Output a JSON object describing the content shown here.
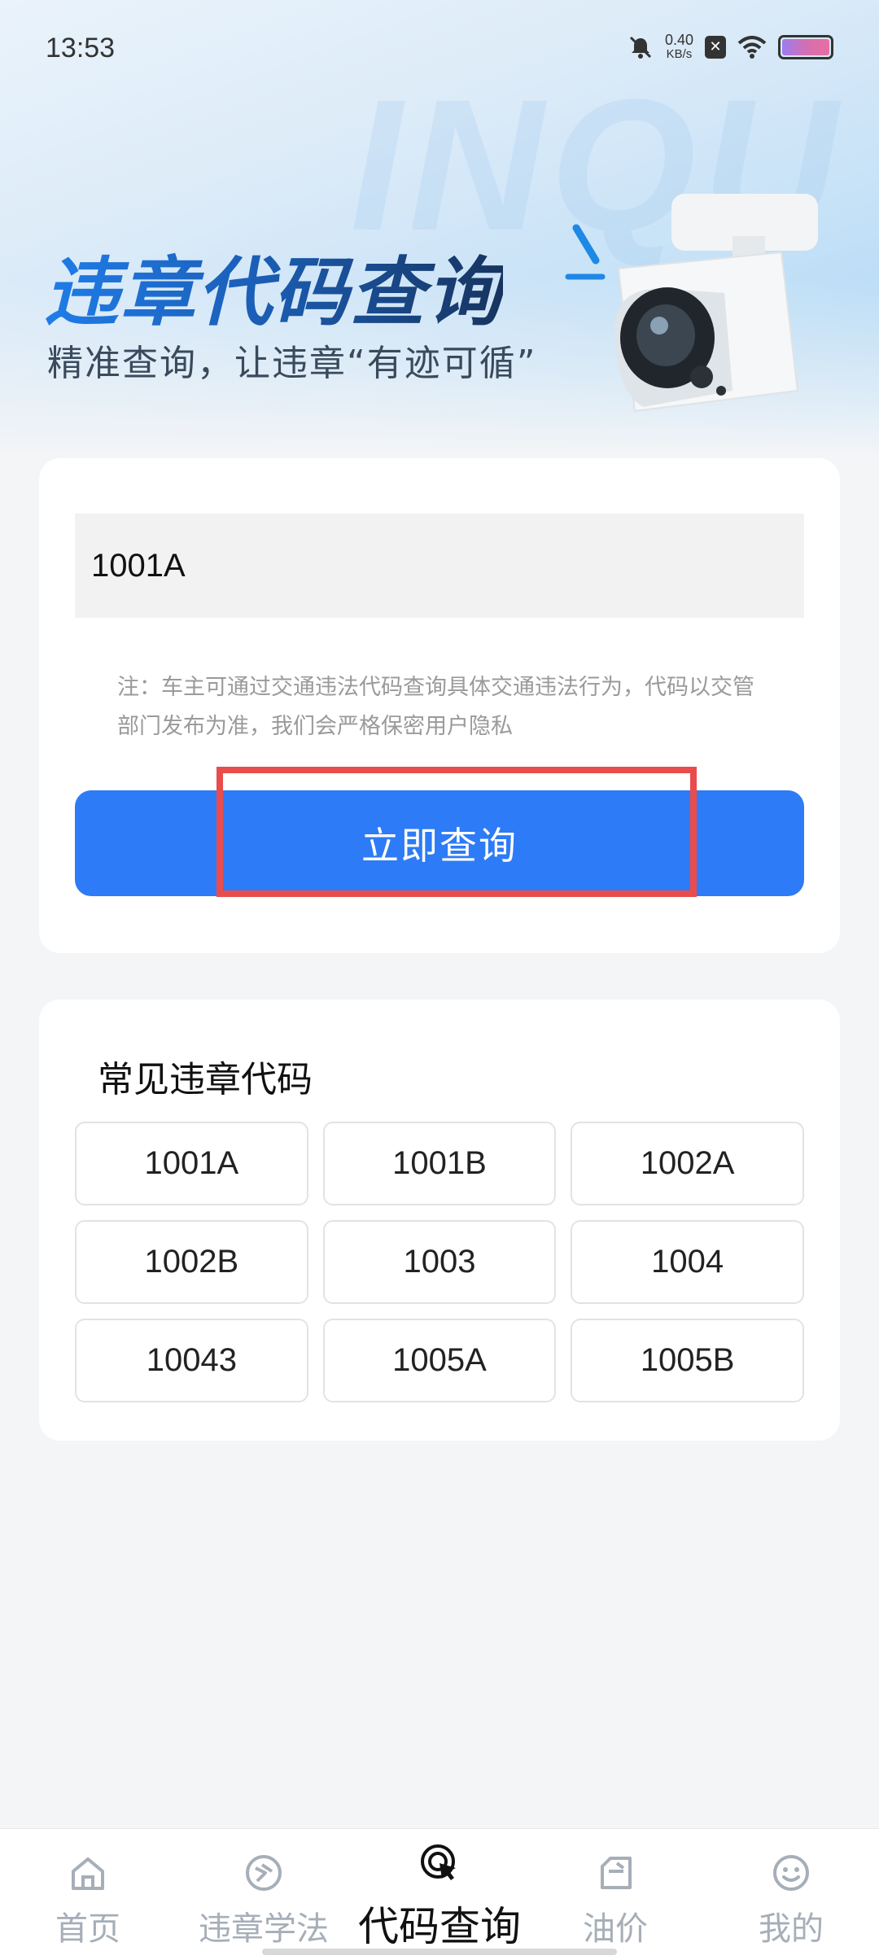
{
  "status_bar": {
    "time": "13:53",
    "net_speed_value": "0.40",
    "net_speed_unit": "KB/s",
    "icons": [
      "mute-icon",
      "close-box-icon",
      "wifi-icon",
      "battery-icon"
    ]
  },
  "hero": {
    "watermark": "INQU",
    "title": "违章代码查询",
    "subtitle": "精准查询，让违章“有迹可循”"
  },
  "search": {
    "input_value": "1001A",
    "note": "注：车主可通过交通违法代码查询具体交通违法行为，代码以交管部门发布为准，我们会严格保密用户隐私",
    "button_label": "立即查询"
  },
  "common_codes": {
    "title": "常见违章代码",
    "codes": [
      "1001A",
      "1001B",
      "1002A",
      "1002B",
      "1003",
      "1004",
      "10043",
      "1005A",
      "1005B"
    ]
  },
  "tabbar": {
    "active_index": 2,
    "tabs": [
      {
        "label": "首页",
        "icon": "home-icon"
      },
      {
        "label": "违章学法",
        "icon": "learn-icon"
      },
      {
        "label": "代码查询",
        "icon": "target-search-icon"
      },
      {
        "label": "油价",
        "icon": "fuel-icon"
      },
      {
        "label": "我的",
        "icon": "smile-icon"
      }
    ]
  },
  "colors": {
    "primary": "#2d7bf6",
    "highlight_box": "#ea4c4c",
    "tab_inactive": "#a6aeb8"
  }
}
